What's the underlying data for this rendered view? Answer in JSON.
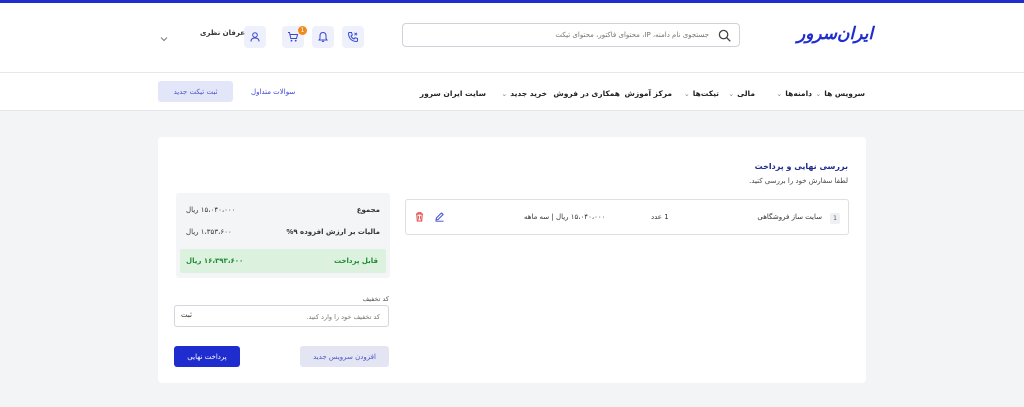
{
  "header": {
    "logo": "ایران‌سرور",
    "search_placeholder": "جستجوی نام دامنه، IP، محتوای فاکتور، محتوای تیکت",
    "cart_badge": "1",
    "username": "عرفان نظری"
  },
  "nav": {
    "items": [
      {
        "label": "سرویس ها",
        "dropdown": true
      },
      {
        "label": "دامنه‌ها",
        "dropdown": true
      },
      {
        "label": "مالی",
        "dropdown": true
      },
      {
        "label": "تیکت‌ها",
        "dropdown": true
      },
      {
        "label": "مرکز آموزش",
        "dropdown": false
      },
      {
        "label": "همکاری در فروش",
        "dropdown": false
      },
      {
        "label": "خرید جدید",
        "dropdown": true
      },
      {
        "label": "سایت ایران سرور",
        "dropdown": false
      }
    ],
    "faq": "سوالات متداول",
    "new_ticket": "ثبت تیکت جدید"
  },
  "checkout": {
    "title": "بررسی نهایی و پرداخت",
    "subtitle": "لطفا سفارش خود را بررسی کنید.",
    "item": {
      "index": "1",
      "name": "سایت ساز فروشگاهی",
      "quantity": "1 عدد",
      "price": "۱۵،۰۴۰،۰۰۰ ریال | سه ماهه"
    },
    "summary": {
      "total_label": "مجموع",
      "total_value": "۱۵،۰۴۰،۰۰۰ ریال",
      "vat_label": "مالیات بر ارزش افزوده ۹%",
      "vat_value": "۱،۳۵۳،۶۰۰ ریال",
      "payable_label": "قابل پرداخت",
      "payable_value": "۱۶،۳۹۳،۶۰۰ ریال"
    },
    "discount": {
      "label": "کد تخفیف",
      "placeholder": "کد تخفیف خود را وارد کنید.",
      "submit": "ثبت"
    },
    "add_service": "افزودن سرویس جدید",
    "pay": "پرداخت نهایی"
  },
  "colors": {
    "brand": "#1f2dcf",
    "success": "#1d8a34",
    "badge": "#f08a1c"
  }
}
